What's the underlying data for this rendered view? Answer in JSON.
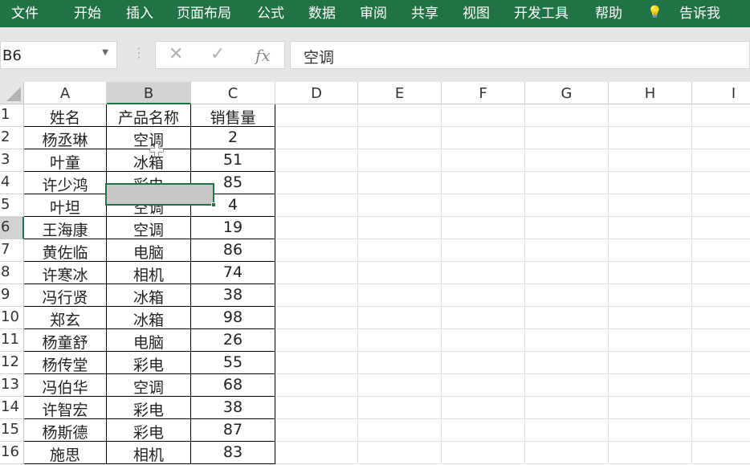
{
  "menu": [
    "文件",
    "开始",
    "插入",
    "页面布局",
    "公式",
    "数据",
    "审阅",
    "共享",
    "视图",
    "开发工具",
    "帮助",
    "告诉我"
  ],
  "name_box": "B6",
  "formula": "空调",
  "columns": [
    "A",
    "B",
    "C",
    "D",
    "E",
    "F",
    "G",
    "H",
    "I"
  ],
  "selected_column": "B",
  "rows": [
    [
      "姓名",
      "产品名称",
      "销售量"
    ],
    [
      "杨丞琳",
      "空调",
      "2"
    ],
    [
      "叶童",
      "冰箱",
      "51"
    ],
    [
      "许少鸿",
      "彩电",
      "85"
    ],
    [
      "叶坦",
      "空调",
      "4"
    ],
    [
      "王海康",
      "空调",
      "19"
    ],
    [
      "黄佐临",
      "电脑",
      "86"
    ],
    [
      "许寒冰",
      "相机",
      "74"
    ],
    [
      "冯行贤",
      "冰箱",
      "38"
    ],
    [
      "郑玄",
      "冰箱",
      "98"
    ],
    [
      "杨童舒",
      "电脑",
      "26"
    ],
    [
      "杨传堂",
      "彩电",
      "55"
    ],
    [
      "冯伯华",
      "空调",
      "68"
    ],
    [
      "许智宏",
      "彩电",
      "38"
    ],
    [
      "杨斯德",
      "彩电",
      "87"
    ],
    [
      "施思",
      "相机",
      "83"
    ]
  ],
  "row_numbers": [
    "1",
    "2",
    "3",
    "4",
    "5",
    "6",
    "7",
    "8",
    "9",
    "10",
    "11",
    "12",
    "13",
    "14",
    "15",
    "16"
  ]
}
